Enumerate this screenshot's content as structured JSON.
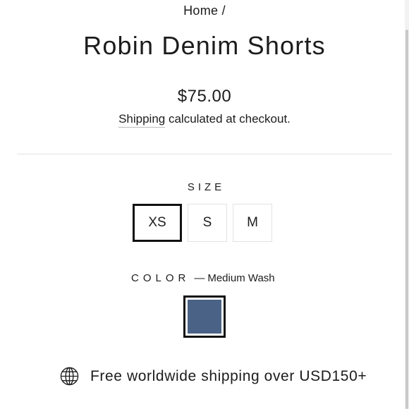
{
  "breadcrumb": {
    "home_label": "Home",
    "separator": "/"
  },
  "product": {
    "title": "Robin Denim Shorts",
    "price": "$75.00"
  },
  "shipping_note": {
    "link_label": "Shipping",
    "text": "calculated at checkout."
  },
  "size": {
    "label": "SIZE",
    "options": [
      "XS",
      "S",
      "M"
    ],
    "selected": "XS"
  },
  "color": {
    "label": "COLOR",
    "dash": "—",
    "value": "Medium Wash",
    "swatch_hex": "#4a6285"
  },
  "free_shipping": {
    "icon": "globe-icon",
    "text": "Free worldwide shipping over USD150+"
  },
  "colors": {
    "text": "#1c1c1c",
    "selected_border": "#111111",
    "option_border": "#e3e3e3",
    "divider": "#e4e4e4"
  }
}
